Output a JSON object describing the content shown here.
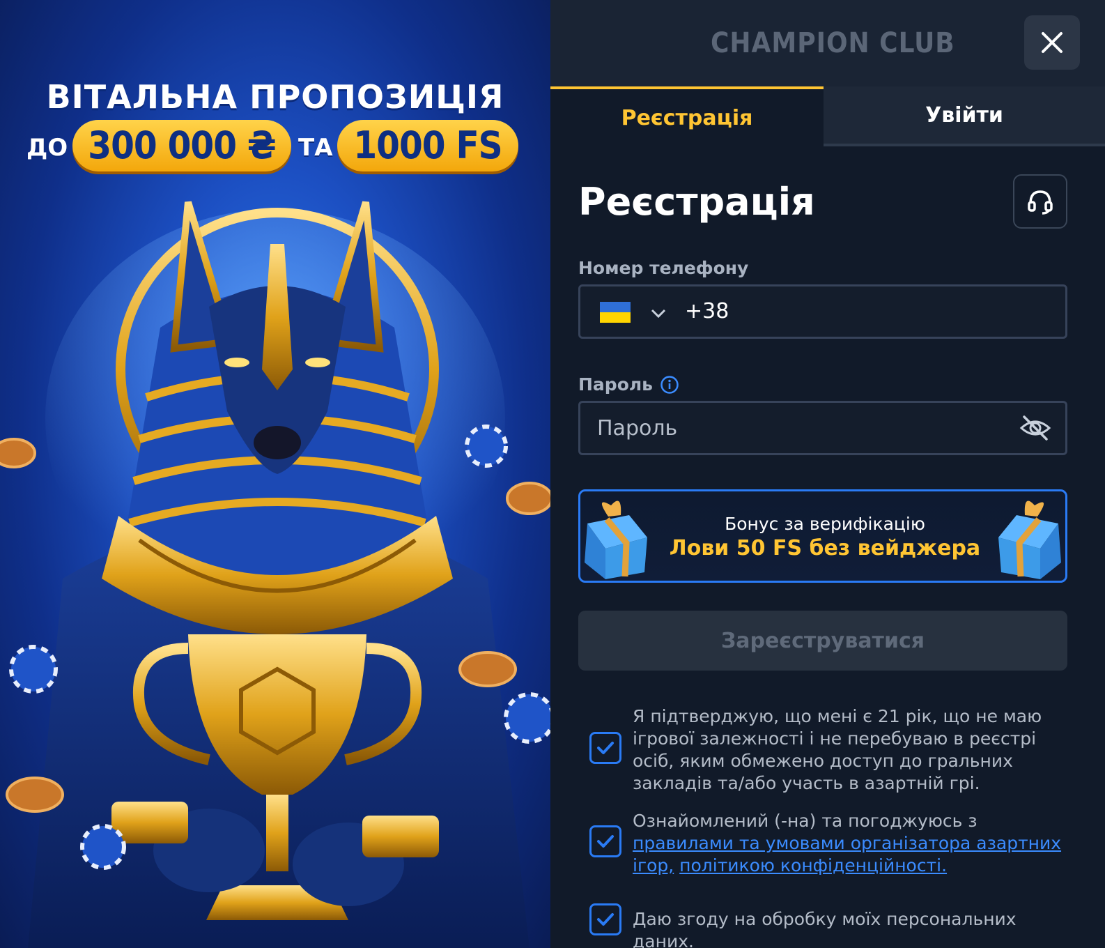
{
  "promo": {
    "title": "ВІТАЛЬНА ПРОПОЗИЦІЯ",
    "prefix": "ДО",
    "amount": "300 000 ₴",
    "joiner": "ТА",
    "spins": "1000 FS"
  },
  "header": {
    "logo_text": "CHAMPION CLUB",
    "close_icon": "close-icon"
  },
  "tabs": [
    {
      "label": "Реєстрація",
      "active": true
    },
    {
      "label": "Увійти",
      "active": false
    }
  ],
  "form": {
    "heading": "Реєстрація",
    "support_icon": "headset-icon",
    "phone_label": "Номер телефону",
    "phone_country": "Ukraine",
    "phone_code": "+38",
    "password_label": "Пароль",
    "password_placeholder": "Пароль",
    "info_icon": "info-icon",
    "eye_icon": "eye-off-icon",
    "submit_label": "Зареєструватися"
  },
  "bonus": {
    "title": "Бонус за верифікацію",
    "offer": "Лови 50 FS без вейджера"
  },
  "consents": [
    {
      "checked": true,
      "text": "Я підтверджую, що мені є 21 рік, що не маю ігрової залежності і не перебуваю в реєстрі осіб, яким обмежено доступ до гральних закладів та/або участь в азартній грі."
    },
    {
      "checked": true,
      "text_before": "Ознайомлений (-на) та погоджуюсь з ",
      "link1": "правилами та умовами організатора азартних ігор,",
      "link2": "політикою конфіденційності."
    },
    {
      "checked": true,
      "text": "Даю згоду на обробку моїх персональних даних."
    }
  ],
  "colors": {
    "accent_yellow": "#ffc533",
    "accent_blue": "#2a7bf5",
    "panel_bg": "#111a29"
  }
}
